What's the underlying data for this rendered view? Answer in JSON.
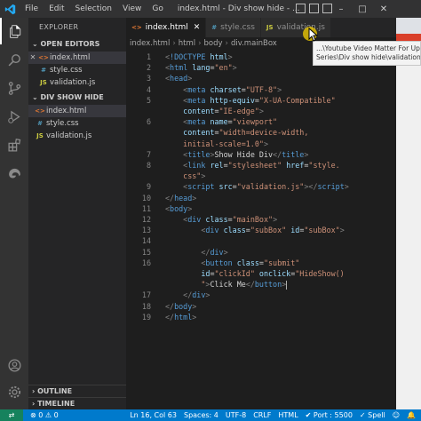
{
  "window": {
    "title": "index.html - Div show hide - ...",
    "menu": [
      "File",
      "Edit",
      "Selection",
      "View",
      "Go"
    ]
  },
  "explorer": {
    "header": "EXPLORER",
    "open_editors_label": "OPEN EDITORS",
    "open_editors": [
      {
        "icon": "<>",
        "name": "index.html",
        "kind": "html"
      },
      {
        "icon": "#",
        "name": "style.css",
        "kind": "css"
      },
      {
        "icon": "JS",
        "name": "validation.js",
        "kind": "js"
      }
    ],
    "folder_label": "DIV SHOW HIDE",
    "files": [
      {
        "icon": "<>",
        "name": "index.html",
        "kind": "html"
      },
      {
        "icon": "#",
        "name": "style.css",
        "kind": "css"
      },
      {
        "icon": "JS",
        "name": "validation.js",
        "kind": "js"
      }
    ],
    "outline_label": "OUTLINE",
    "timeline_label": "TIMELINE"
  },
  "tabs": [
    {
      "icon": "<>",
      "label": "index.html",
      "active": true,
      "kind": "html"
    },
    {
      "icon": "#",
      "label": "style.css",
      "active": false,
      "kind": "css"
    },
    {
      "icon": "JS",
      "label": "validation.js",
      "active": false,
      "kind": "js"
    }
  ],
  "breadcrumb": [
    "index.html",
    "html",
    "body",
    "div.mainBox"
  ],
  "tooltip": {
    "line1": "...\\Youtube Video Matter For Uplo",
    "line2": "Series\\Div show hide\\validation.js"
  },
  "code_lines": [
    {
      "n": "1",
      "tokens": [
        [
          "t-punc",
          "<"
        ],
        [
          "t-tag",
          "!DOCTYPE"
        ],
        [
          "t-text",
          " "
        ],
        [
          "t-attr",
          "html"
        ],
        [
          "t-punc",
          ">"
        ]
      ]
    },
    {
      "n": "2",
      "tokens": [
        [
          "t-punc",
          "<"
        ],
        [
          "t-tag",
          "html"
        ],
        [
          "t-text",
          " "
        ],
        [
          "t-attr",
          "lang"
        ],
        [
          "t-text",
          "="
        ],
        [
          "t-str",
          "\"en\""
        ],
        [
          "t-punc",
          ">"
        ]
      ]
    },
    {
      "n": "3",
      "tokens": [
        [
          "t-punc",
          "<"
        ],
        [
          "t-tag",
          "head"
        ],
        [
          "t-punc",
          ">"
        ]
      ]
    },
    {
      "n": "4",
      "tokens": [
        [
          "t-text",
          "    "
        ],
        [
          "t-punc",
          "<"
        ],
        [
          "t-tag",
          "meta"
        ],
        [
          "t-text",
          " "
        ],
        [
          "t-attr",
          "charset"
        ],
        [
          "t-text",
          "="
        ],
        [
          "t-str",
          "\"UTF-8\""
        ],
        [
          "t-punc",
          ">"
        ]
      ]
    },
    {
      "n": "5",
      "tokens": [
        [
          "t-text",
          "    "
        ],
        [
          "t-punc",
          "<"
        ],
        [
          "t-tag",
          "meta"
        ],
        [
          "t-text",
          " "
        ],
        [
          "t-attr",
          "http-equiv"
        ],
        [
          "t-text",
          "="
        ],
        [
          "t-str",
          "\"X-UA-Compatible\""
        ]
      ]
    },
    {
      "n": "",
      "tokens": [
        [
          "t-text",
          "    "
        ],
        [
          "t-attr",
          "content"
        ],
        [
          "t-text",
          "="
        ],
        [
          "t-str",
          "\"IE-edge\""
        ],
        [
          "t-punc",
          ">"
        ]
      ]
    },
    {
      "n": "6",
      "tokens": [
        [
          "t-text",
          "    "
        ],
        [
          "t-punc",
          "<"
        ],
        [
          "t-tag",
          "meta"
        ],
        [
          "t-text",
          " "
        ],
        [
          "t-attr",
          "name"
        ],
        [
          "t-text",
          "="
        ],
        [
          "t-str",
          "\"viewport\""
        ]
      ]
    },
    {
      "n": "",
      "tokens": [
        [
          "t-text",
          "    "
        ],
        [
          "t-attr",
          "content"
        ],
        [
          "t-text",
          "="
        ],
        [
          "t-str",
          "\"width=device-width,"
        ]
      ]
    },
    {
      "n": "",
      "tokens": [
        [
          "t-text",
          "    "
        ],
        [
          "t-str",
          "initial-scale=1.0\""
        ],
        [
          "t-punc",
          ">"
        ]
      ]
    },
    {
      "n": "7",
      "tokens": [
        [
          "t-text",
          "    "
        ],
        [
          "t-punc",
          "<"
        ],
        [
          "t-tag",
          "title"
        ],
        [
          "t-punc",
          ">"
        ],
        [
          "t-text",
          "Show Hide Div"
        ],
        [
          "t-punc",
          "</"
        ],
        [
          "t-tag",
          "title"
        ],
        [
          "t-punc",
          ">"
        ]
      ]
    },
    {
      "n": "8",
      "tokens": [
        [
          "t-text",
          "    "
        ],
        [
          "t-punc",
          "<"
        ],
        [
          "t-tag",
          "link"
        ],
        [
          "t-text",
          " "
        ],
        [
          "t-attr",
          "rel"
        ],
        [
          "t-text",
          "="
        ],
        [
          "t-str",
          "\"stylesheet\""
        ],
        [
          "t-text",
          " "
        ],
        [
          "t-attr",
          "href"
        ],
        [
          "t-text",
          "="
        ],
        [
          "t-str",
          "\"style."
        ]
      ]
    },
    {
      "n": "",
      "tokens": [
        [
          "t-text",
          "    "
        ],
        [
          "t-str",
          "css\""
        ],
        [
          "t-punc",
          ">"
        ]
      ]
    },
    {
      "n": "9",
      "tokens": [
        [
          "t-text",
          "    "
        ],
        [
          "t-punc",
          "<"
        ],
        [
          "t-tag",
          "script"
        ],
        [
          "t-text",
          " "
        ],
        [
          "t-attr",
          "src"
        ],
        [
          "t-text",
          "="
        ],
        [
          "t-str",
          "\"validation.js\""
        ],
        [
          "t-punc",
          "></"
        ],
        [
          "t-tag",
          "script"
        ],
        [
          "t-punc",
          ">"
        ]
      ]
    },
    {
      "n": "10",
      "tokens": [
        [
          "t-punc",
          "</"
        ],
        [
          "t-tag",
          "head"
        ],
        [
          "t-punc",
          ">"
        ]
      ]
    },
    {
      "n": "11",
      "tokens": [
        [
          "t-punc",
          "<"
        ],
        [
          "t-tag",
          "body"
        ],
        [
          "t-punc",
          ">"
        ]
      ]
    },
    {
      "n": "12",
      "tokens": [
        [
          "t-text",
          "    "
        ],
        [
          "t-punc",
          "<"
        ],
        [
          "t-tag",
          "div"
        ],
        [
          "t-text",
          " "
        ],
        [
          "t-attr",
          "class"
        ],
        [
          "t-text",
          "="
        ],
        [
          "t-str",
          "\"mainBox\""
        ],
        [
          "t-punc",
          ">"
        ]
      ]
    },
    {
      "n": "13",
      "tokens": [
        [
          "t-text",
          "        "
        ],
        [
          "t-punc",
          "<"
        ],
        [
          "t-tag",
          "div"
        ],
        [
          "t-text",
          " "
        ],
        [
          "t-attr",
          "class"
        ],
        [
          "t-text",
          "="
        ],
        [
          "t-str",
          "\"subBox\""
        ],
        [
          "t-text",
          " "
        ],
        [
          "t-attr",
          "id"
        ],
        [
          "t-text",
          "="
        ],
        [
          "t-str",
          "\"subBox\""
        ],
        [
          "t-punc",
          ">"
        ]
      ]
    },
    {
      "n": "14",
      "tokens": []
    },
    {
      "n": "15",
      "tokens": [
        [
          "t-text",
          "        "
        ],
        [
          "t-punc",
          "</"
        ],
        [
          "t-tag",
          "div"
        ],
        [
          "t-punc",
          ">"
        ]
      ]
    },
    {
      "n": "16",
      "tokens": [
        [
          "t-text",
          "        "
        ],
        [
          "t-punc",
          "<"
        ],
        [
          "t-tag",
          "button"
        ],
        [
          "t-text",
          " "
        ],
        [
          "t-attr",
          "class"
        ],
        [
          "t-text",
          "="
        ],
        [
          "t-str",
          "\"submit\""
        ]
      ]
    },
    {
      "n": "",
      "tokens": [
        [
          "t-text",
          "        "
        ],
        [
          "t-attr",
          "id"
        ],
        [
          "t-text",
          "="
        ],
        [
          "t-str",
          "\"clickId\""
        ],
        [
          "t-text",
          " "
        ],
        [
          "t-attr",
          "onclick"
        ],
        [
          "t-text",
          "="
        ],
        [
          "t-str",
          "\"HideShow()"
        ]
      ]
    },
    {
      "n": "",
      "tokens": [
        [
          "t-text",
          "        "
        ],
        [
          "t-str",
          "\""
        ],
        [
          "t-punc",
          ">"
        ],
        [
          "t-text",
          "Click Me"
        ],
        [
          "t-punc",
          "</"
        ],
        [
          "t-tag",
          "button"
        ],
        [
          "t-punc",
          ">"
        ],
        [
          "cursor",
          ""
        ]
      ]
    },
    {
      "n": "17",
      "tokens": [
        [
          "t-text",
          "    "
        ],
        [
          "t-punc",
          "</"
        ],
        [
          "t-tag",
          "div"
        ],
        [
          "t-punc",
          ">"
        ]
      ]
    },
    {
      "n": "18",
      "tokens": [
        [
          "t-punc",
          "</"
        ],
        [
          "t-tag",
          "body"
        ],
        [
          "t-punc",
          ">"
        ]
      ]
    },
    {
      "n": "19",
      "tokens": [
        [
          "t-punc",
          "</"
        ],
        [
          "t-tag",
          "html"
        ],
        [
          "t-punc",
          ">"
        ]
      ]
    }
  ],
  "status": {
    "cursor_pos": "Ln 16, Col 63",
    "spaces": "Spaces: 4",
    "encoding": "UTF-8",
    "eol": "CRLF",
    "language": "HTML",
    "port": "Port : 5500",
    "spell": "Spell"
  },
  "colors": {
    "status_bar": "#007acc",
    "tag": "#569cd6",
    "attribute": "#9cdcfe",
    "string": "#ce9178",
    "html_icon": "#e37933",
    "css_icon": "#519aba",
    "js_icon": "#cbcb41"
  }
}
